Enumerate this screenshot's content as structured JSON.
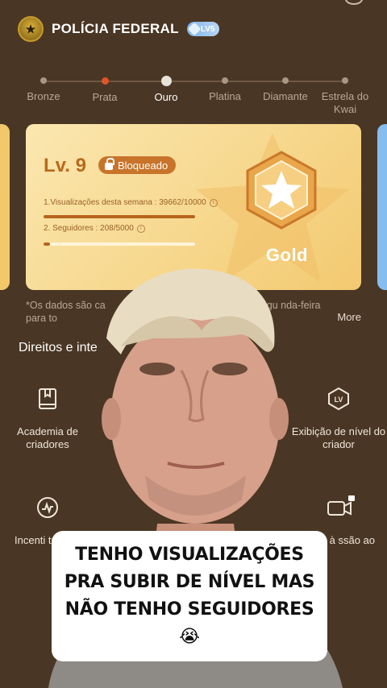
{
  "header": {
    "title": "POLÍCIA FEDERAL",
    "level_badge": "LV5",
    "logo_icon": "police-badge-icon"
  },
  "tiers": [
    {
      "label": "Bronze",
      "state": "past"
    },
    {
      "label": "Prata",
      "state": "current-red"
    },
    {
      "label": "Ouro",
      "state": "active"
    },
    {
      "label": "Platina",
      "state": "future"
    },
    {
      "label": "Diamante",
      "state": "future"
    },
    {
      "label": "Estrela do Kwai",
      "state": "future"
    }
  ],
  "card": {
    "level": "Lv. 9",
    "status": "Bloqueado",
    "req1": "1.Visualizações desta semana : 39662/10000",
    "req1_progress": 1.0,
    "req2": "2. Seguidores : 208/5000",
    "req2_progress": 0.04,
    "tier_name": "Gold"
  },
  "note": {
    "text": "*Os dados são ca                                          oite da segu nda-feira para to                                          lizados t...",
    "more": "More"
  },
  "section_title": "Direitos e inte",
  "features": [
    {
      "label": "Academia de criadores",
      "icon": "book-icon"
    },
    {
      "label": "Exibição de nível do criador",
      "icon": "level-shield-icon"
    },
    {
      "label": "Incenti tráfe",
      "icon": "heartbeat-icon"
    },
    {
      "label": "esso à ssão ao",
      "icon": "video-camera-locked-icon"
    }
  ],
  "caption": {
    "text": "TENHO VISUALIZAÇÕES PRA SUBIR DE NÍVEL MAS NÃO TENHO SEGUIDORES 😭"
  },
  "colors": {
    "background": "#4a3624",
    "accent_gold": "#f6d68a",
    "accent_orange": "#c8742a"
  }
}
